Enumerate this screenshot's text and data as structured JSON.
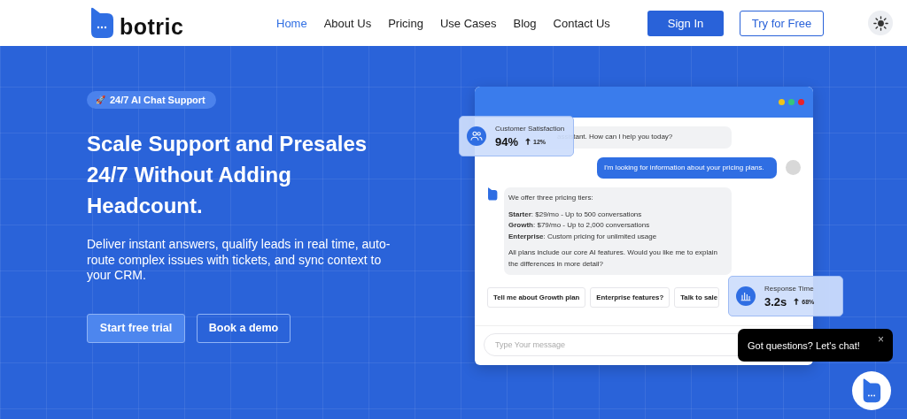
{
  "nav": {
    "logo": "botric",
    "links": [
      {
        "label": "Home",
        "selected": true
      },
      {
        "label": "About Us",
        "selected": false
      },
      {
        "label": "Pricing",
        "selected": false
      },
      {
        "label": "Use Cases",
        "selected": false
      },
      {
        "label": "Blog",
        "selected": false
      },
      {
        "label": "Contact Us",
        "selected": false
      }
    ],
    "sign_in": "Sign In",
    "try_free": "Try for Free"
  },
  "hero": {
    "badge_icon": "🚀",
    "badge": "24/7 AI Chat Support",
    "headline": [
      "Scale Support and Presales",
      "24/7 Without Adding",
      "Headcount."
    ],
    "description": "Deliver instant answers, qualify leads in real time, auto-route complex issues with tickets, and sync context to your CRM.",
    "buttons": [
      {
        "label": "Start free trial",
        "kind": "primary"
      },
      {
        "label": "Book a demo",
        "kind": "outline"
      }
    ]
  },
  "chat_window": {
    "messages": [
      {
        "kind": "bot",
        "paragraphs": [
          "assistant. How can I help you today?"
        ]
      },
      {
        "kind": "user",
        "paragraphs": [
          "I'm looking for information about your pricing plans."
        ]
      },
      {
        "kind": "bot",
        "paragraphs": [
          "We offer three pricing tiers:",
          "**Starter**: $29/mo - Up to 500 conversations\n**Growth**: $79/mo - Up to 2,000 conversations\n**Enterprise**: Custom pricing for unlimited usage",
          "All plans include our core AI features. Would you like me to explain the differences in more detail?"
        ]
      }
    ],
    "suggestions": [
      "Tell me about Growth plan",
      "Enterprise features?",
      "Talk to sale"
    ],
    "input": {
      "placeholder": "Type Your message"
    }
  },
  "stat_cards": [
    {
      "kind": "people",
      "label": "Customer Satisfaction",
      "value": "94%",
      "change": "12%"
    },
    {
      "kind": "chart",
      "label": "Response Time",
      "value": "3.2s",
      "change": "68%"
    }
  ],
  "chat_prompt": {
    "text": "Got questions? Let's chat!",
    "close": "×"
  }
}
